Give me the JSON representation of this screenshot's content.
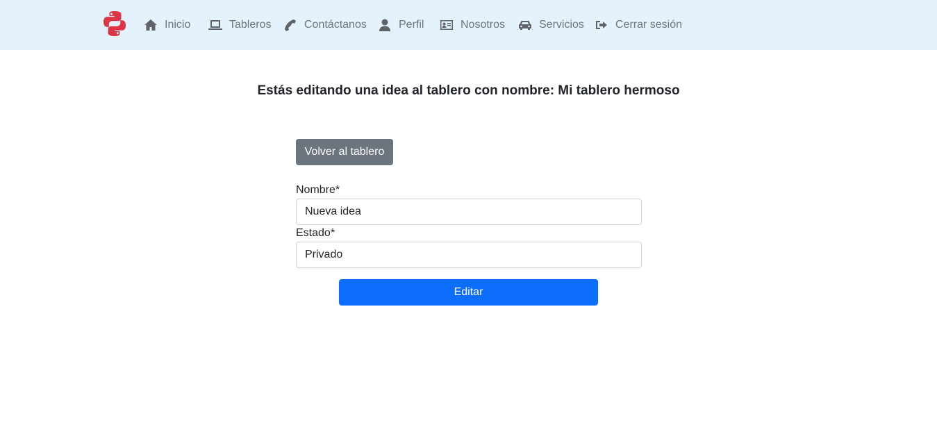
{
  "colors": {
    "navbar_bg": "#e3f2fd",
    "logo_red": "#dc3545",
    "secondary_button": "#6c757d",
    "primary_button": "#0d6efd"
  },
  "nav": {
    "logo_icon": "python-logo-icon",
    "items": [
      {
        "label": "Inicio",
        "icon": "home-icon"
      },
      {
        "label": "Tableros",
        "icon": "laptop-icon"
      },
      {
        "label": "Contáctanos",
        "icon": "phone-icon"
      },
      {
        "label": "Perfil",
        "icon": "user-icon"
      },
      {
        "label": "Nosotros",
        "icon": "id-card-icon"
      },
      {
        "label": "Servicios",
        "icon": "car-icon"
      },
      {
        "label": "Cerrar sesión",
        "icon": "sign-out-icon"
      }
    ]
  },
  "page": {
    "heading": "Estás editando una idea al tablero con nombre: Mi tablero hermoso"
  },
  "form": {
    "back_label": "Volver al tablero",
    "name_label": "Nombre*",
    "name_value": "Nueva idea",
    "status_label": "Estado*",
    "status_value": "Privado",
    "submit_label": "Editar"
  }
}
